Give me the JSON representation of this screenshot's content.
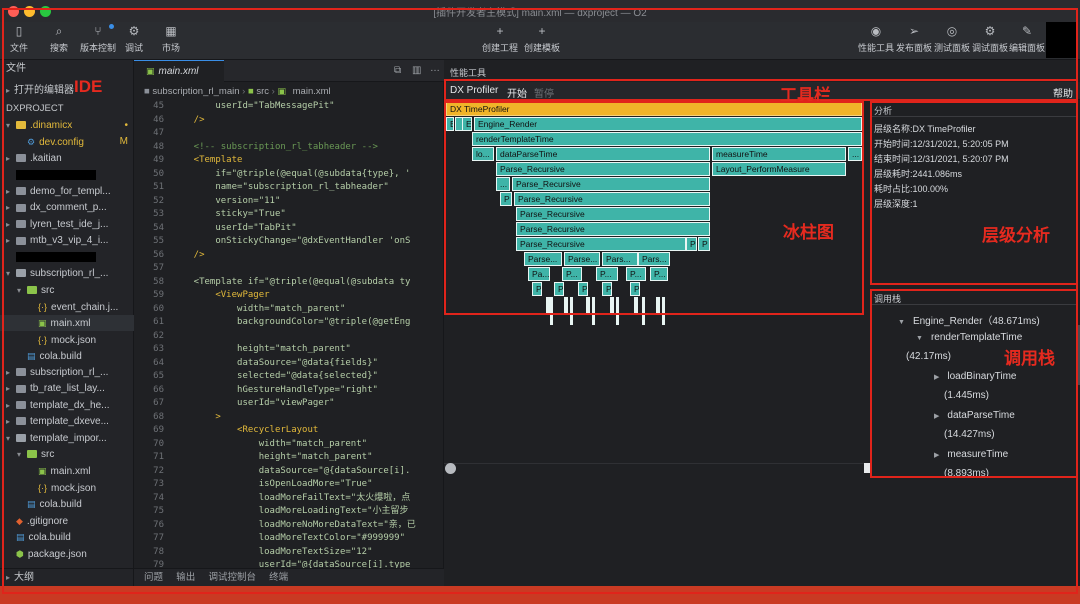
{
  "window": {
    "title": "[插件开发者主模式] main.xml — dxproject — O2"
  },
  "toolbar": {
    "left": [
      {
        "label": "文件",
        "icon": "file-icon"
      },
      {
        "label": "搜索",
        "icon": "search-icon"
      },
      {
        "label": "版本控制",
        "icon": "branch-icon"
      },
      {
        "label": "调试",
        "icon": "debug-icon"
      },
      {
        "label": "市场",
        "icon": "market-icon"
      }
    ],
    "center": [
      {
        "label": "创建工程",
        "icon": "plus-icon"
      },
      {
        "label": "创建模板",
        "icon": "plus-icon"
      }
    ],
    "right": [
      {
        "label": "性能工具",
        "icon": "perf-icon"
      },
      {
        "label": "发布面板",
        "icon": "send-icon"
      },
      {
        "label": "测试面板",
        "icon": "test-icon"
      },
      {
        "label": "调试面板",
        "icon": "bug-icon"
      },
      {
        "label": "编辑面板",
        "icon": "edit-icon"
      }
    ]
  },
  "sidebar": {
    "title": "文件",
    "open_editors": "打开的编辑器",
    "project": "DXPROJECT",
    "items": [
      {
        "label": ".dinamicx",
        "type": "folder-open",
        "indent": 1,
        "mark": "•"
      },
      {
        "label": "dev.config",
        "type": "gear",
        "indent": 2,
        "mark": "M"
      },
      {
        "label": ".kaitian",
        "type": "folder",
        "indent": 1
      },
      {
        "label": "",
        "type": "redacted",
        "indent": 1
      },
      {
        "label": "demo_for_templ...",
        "type": "folder",
        "indent": 1
      },
      {
        "label": "dx_comment_p...",
        "type": "folder",
        "indent": 1
      },
      {
        "label": "lyren_test_ide_j...",
        "type": "folder",
        "indent": 1
      },
      {
        "label": "mtb_v3_vip_4_i...",
        "type": "folder",
        "indent": 1
      },
      {
        "label": "",
        "type": "redacted",
        "indent": 1
      },
      {
        "label": "subscription_rl_...",
        "type": "folder-open",
        "indent": 1
      },
      {
        "label": "src",
        "type": "src-open",
        "indent": 2
      },
      {
        "label": "event_chain.j...",
        "type": "json",
        "indent": 3
      },
      {
        "label": "main.xml",
        "type": "xml",
        "indent": 3,
        "selected": true
      },
      {
        "label": "mock.json",
        "type": "json",
        "indent": 3
      },
      {
        "label": "cola.build",
        "type": "cola",
        "indent": 2
      },
      {
        "label": "subscription_rl_...",
        "type": "folder",
        "indent": 1
      },
      {
        "label": "tb_rate_list_lay...",
        "type": "folder",
        "indent": 1
      },
      {
        "label": "template_dx_he...",
        "type": "folder",
        "indent": 1
      },
      {
        "label": "template_dxeve...",
        "type": "folder",
        "indent": 1
      },
      {
        "label": "template_impor...",
        "type": "folder-open",
        "indent": 1
      },
      {
        "label": "src",
        "type": "src-open",
        "indent": 2
      },
      {
        "label": "main.xml",
        "type": "xml",
        "indent": 3
      },
      {
        "label": "mock.json",
        "type": "json",
        "indent": 3
      },
      {
        "label": "cola.build",
        "type": "cola",
        "indent": 2
      },
      {
        "label": ".gitignore",
        "type": "git",
        "indent": 1
      },
      {
        "label": "cola.build",
        "type": "cola",
        "indent": 1
      },
      {
        "label": "package.json",
        "type": "pkg",
        "indent": 1
      }
    ],
    "outline": "大纲"
  },
  "editor": {
    "tab": "main.xml",
    "breadcrumb": [
      "subscription_rl_main",
      "src",
      "main.xml"
    ],
    "lines": [
      {
        "n": "45",
        "t": "        userId=\"TabMessagePit\""
      },
      {
        "n": "46",
        "t": "    />"
      },
      {
        "n": "47",
        "t": ""
      },
      {
        "n": "48",
        "t": "    <!-- subscription_rl_tabheader -->"
      },
      {
        "n": "49",
        "t": "    <Template"
      },
      {
        "n": "50",
        "t": "        if=\"@triple(@equal(@subdata{type}, '"
      },
      {
        "n": "51",
        "t": "        name=\"subscription_rl_tabheader\""
      },
      {
        "n": "52",
        "t": "        version=\"11\""
      },
      {
        "n": "53",
        "t": "        sticky=\"True\""
      },
      {
        "n": "54",
        "t": "        userId=\"TabPit\""
      },
      {
        "n": "55",
        "t": "        onStickyChange=\"@dxEventHandler 'onS"
      },
      {
        "n": "56",
        "t": "    />"
      },
      {
        "n": "57",
        "t": ""
      },
      {
        "n": "58",
        "t": "    <Template if=\"@triple(@equal(@subdata ty"
      },
      {
        "n": "59",
        "t": "        <ViewPager"
      },
      {
        "n": "60",
        "t": "            width=\"match_parent\""
      },
      {
        "n": "61",
        "t": "            backgroundColor=\"@triple(@getEng"
      },
      {
        "n": "62",
        "t": ""
      },
      {
        "n": "63",
        "t": "            height=\"match_parent\""
      },
      {
        "n": "64",
        "t": "            dataSource=\"@data{fields}\""
      },
      {
        "n": "65",
        "t": "            selected=\"@data{selected}\""
      },
      {
        "n": "66",
        "t": "            hGestureHandleType=\"right\""
      },
      {
        "n": "67",
        "t": "            userId=\"viewPager\""
      },
      {
        "n": "68",
        "t": "        >"
      },
      {
        "n": "69",
        "t": "            <RecyclerLayout"
      },
      {
        "n": "70",
        "t": "                width=\"match_parent\""
      },
      {
        "n": "71",
        "t": "                height=\"match_parent\""
      },
      {
        "n": "72",
        "t": "                dataSource=\"@{dataSource[i]."
      },
      {
        "n": "73",
        "t": "                isOpenLoadMore=\"True\""
      },
      {
        "n": "74",
        "t": "                loadMoreFailText=\"太火爆啦，点"
      },
      {
        "n": "75",
        "t": "                loadMoreLoadingText=\"小主留步"
      },
      {
        "n": "76",
        "t": "                loadMoreNoMoreDataText=\"亲，已"
      },
      {
        "n": "77",
        "t": "                loadMoreTextColor=\"#999999\""
      },
      {
        "n": "78",
        "t": "                loadMoreTextSize=\"12\""
      },
      {
        "n": "79",
        "t": "                userId=\"@{dataSource[i].type"
      }
    ],
    "bottom_tabs": [
      "问题",
      "输出",
      "调试控制台",
      "终端"
    ]
  },
  "perf": {
    "panel_title": "性能工具",
    "toolbar": {
      "profiler": "DX Profiler",
      "start": "开始",
      "pause": "暂停",
      "help": "帮助"
    },
    "flame": {
      "root": "DX TimeProfiler",
      "rows": [
        [
          {
            "label": "E"
          },
          {
            "label": ""
          },
          {
            "label": "E"
          },
          {
            "label": "Engine_Render"
          }
        ],
        [
          {
            "label": "renderTemplateTime"
          }
        ],
        [
          {
            "label": "lo..."
          },
          {
            "label": "dataParseTime"
          },
          {
            "label": "measureTime"
          },
          {
            "label": "..."
          }
        ],
        [
          {
            "label": "Parse_Recursive"
          },
          {
            "label": "Layout_PerformMeasure"
          }
        ],
        [
          {
            "label": "..."
          },
          {
            "label": "Parse_Recursive"
          }
        ],
        [
          {
            "label": "P"
          },
          {
            "label": "Parse_Recursive"
          }
        ],
        [
          {
            "label": "Parse_Recursive"
          }
        ],
        [
          {
            "label": "Parse_Recursive"
          }
        ],
        [
          {
            "label": "Parse_Recursive"
          },
          {
            "label": "P"
          },
          {
            "label": "P"
          }
        ],
        [
          {
            "label": "Parse..."
          },
          {
            "label": "Parse..."
          },
          {
            "label": "Pars..."
          },
          {
            "label": "Pars..."
          }
        ],
        [
          {
            "label": "Pa..."
          },
          {
            "label": "P..."
          },
          {
            "label": "P..."
          },
          {
            "label": "P..."
          },
          {
            "label": "P..."
          }
        ],
        [
          {
            "label": "P"
          },
          {
            "label": "P"
          },
          {
            "label": "P"
          },
          {
            "label": "P"
          },
          {
            "label": "P"
          }
        ]
      ]
    },
    "analysis": {
      "title": "分析",
      "rows": [
        {
          "k": "层级名称:",
          "v": "DX TimeProfiler"
        },
        {
          "k": "开始时间:",
          "v": "12/31/2021, 5:20:05 PM"
        },
        {
          "k": "结束时间:",
          "v": "12/31/2021, 5:20:07 PM"
        },
        {
          "k": "层级耗时:",
          "v": "2441.086ms"
        },
        {
          "k": "耗时占比:",
          "v": "100.00%"
        },
        {
          "k": "层级深度:",
          "v": "1"
        }
      ]
    },
    "callstack": {
      "title": "调用栈",
      "nodes": [
        {
          "label": "Engine_Render（48.671ms)",
          "depth": 0,
          "open": true
        },
        {
          "label": "renderTemplateTime",
          "depth": 1,
          "open": true
        },
        {
          "label": "(42.17ms)",
          "depth": 1,
          "cont": true
        },
        {
          "label": "loadBinaryTime",
          "depth": 2
        },
        {
          "label": "(1.445ms)",
          "depth": 2,
          "cont": true
        },
        {
          "label": "dataParseTime",
          "depth": 2
        },
        {
          "label": "(14.427ms)",
          "depth": 2,
          "cont": true
        },
        {
          "label": "measureTime",
          "depth": 2
        },
        {
          "label": "(8.893ms)",
          "depth": 2,
          "cont": true
        }
      ]
    }
  },
  "annotations": {
    "ide": "IDE",
    "toolbar": "工具栏",
    "flame": "冰柱图",
    "analysis": "层级分析",
    "callstack": "调用栈"
  }
}
